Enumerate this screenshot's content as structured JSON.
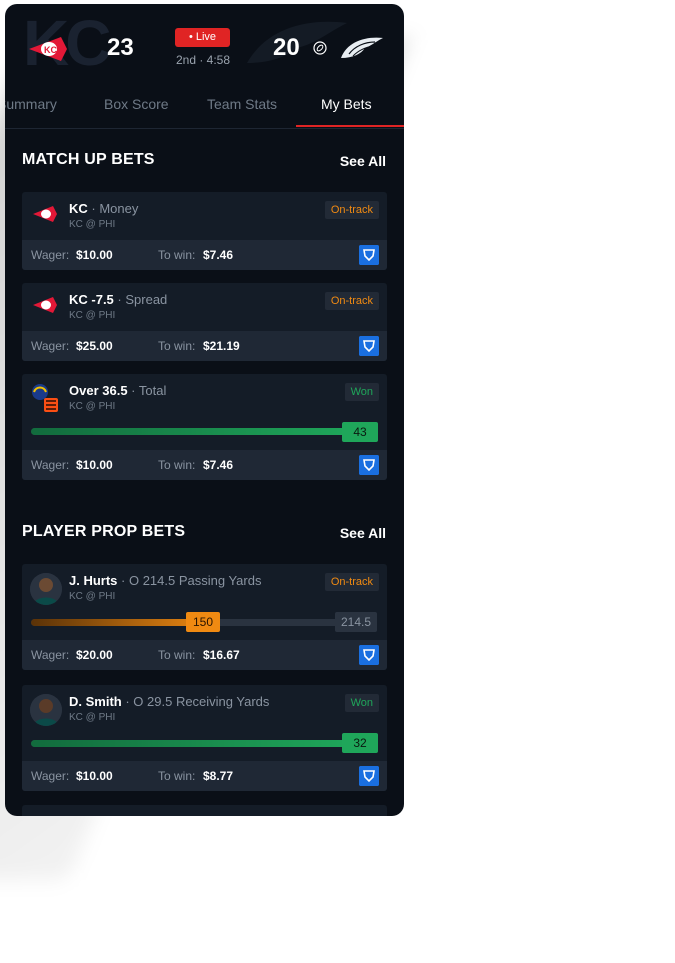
{
  "game": {
    "home_score": "23",
    "away_score": "20",
    "live_label": "• Live",
    "clock": "2nd · 4:58"
  },
  "tabs": [
    {
      "label": "Summary"
    },
    {
      "label": "Box Score"
    },
    {
      "label": "Team Stats"
    },
    {
      "label": "My Bets"
    }
  ],
  "matchup": {
    "title": "MATCH UP BETS",
    "see_all": "See All",
    "bets": [
      {
        "pick": "KC",
        "type": "· Money",
        "game": "KC @ PHI",
        "status": "On-track",
        "wager_label": "Wager:",
        "wager": "$10.00",
        "towin_label": "To win:",
        "towin": "$7.46"
      },
      {
        "pick": "KC -7.5",
        "type": "· Spread",
        "game": "KC @ PHI",
        "status": "On-track",
        "wager_label": "Wager:",
        "wager": "$25.00",
        "towin_label": "To win:",
        "towin": "$21.19"
      },
      {
        "pick": "Over 36.5",
        "type": "· Total",
        "game": "KC @ PHI",
        "status": "Won",
        "progress_value": "43",
        "progress_fraction": 1.0,
        "wager_label": "Wager:",
        "wager": "$10.00",
        "towin_label": "To win:",
        "towin": "$7.46"
      }
    ]
  },
  "props": {
    "title": "PLAYER PROP BETS",
    "see_all": "See All",
    "bets": [
      {
        "pick": "J. Hurts",
        "type": "· O 214.5 Passing Yards",
        "game": "KC @ PHI",
        "status": "On-track",
        "progress_value": "150",
        "line": "214.5",
        "progress_fraction": 0.7,
        "wager_label": "Wager:",
        "wager": "$20.00",
        "towin_label": "To win:",
        "towin": "$16.67"
      },
      {
        "pick": "D. Smith",
        "type": "· O 29.5 Receiving Yards",
        "game": "KC @ PHI",
        "status": "Won",
        "progress_value": "32",
        "progress_fraction": 1.0,
        "wager_label": "Wager:",
        "wager": "$10.00",
        "towin_label": "To win:",
        "towin": "$8.77"
      }
    ]
  },
  "colors": {
    "live": "#e02424",
    "ontrack": "#f08a12",
    "won": "#1fa65a",
    "book": "#1a6fe0"
  },
  "icons": [
    "chiefs-logo",
    "eagles-logo",
    "football-icon",
    "sportsbook-shield-icon",
    "rams-logo",
    "bengals-logo"
  ]
}
